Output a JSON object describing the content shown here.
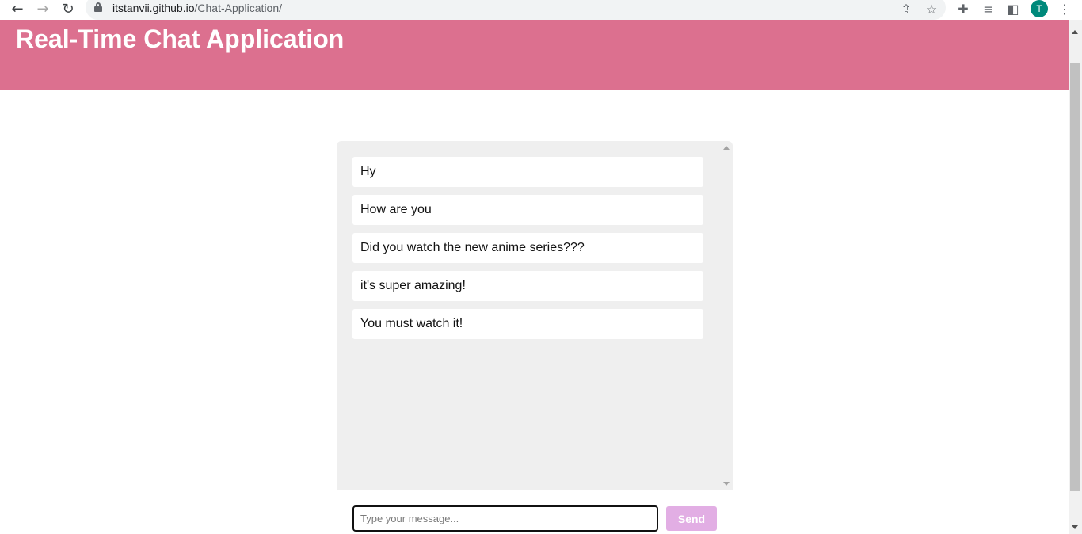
{
  "browser": {
    "url_host": "itstanvii.github.io",
    "url_path": "/Chat-Application/",
    "profile_initial": "T",
    "icons": {
      "back": "arrow-left-icon",
      "forward": "arrow-right-icon",
      "reload": "reload-icon",
      "lock": "lock-icon",
      "share": "share-icon",
      "bookmark": "star-icon",
      "extensions": "puzzle-icon",
      "media": "media-controls-icon",
      "side_panel": "side-panel-icon",
      "menu": "kebab-menu-icon"
    }
  },
  "header": {
    "title": "Real-Time Chat Application"
  },
  "chat": {
    "messages": [
      "Hy",
      "How are you",
      "Did you watch the new anime series???",
      "it's super amazing!",
      "You must watch it!"
    ]
  },
  "composer": {
    "placeholder": "Type your message...",
    "value": "",
    "send_label": "Send"
  },
  "colors": {
    "header_bg": "#dc708f",
    "chat_bg": "#efefef",
    "send_bg": "#e2aee4",
    "avatar_bg": "#00897b"
  }
}
